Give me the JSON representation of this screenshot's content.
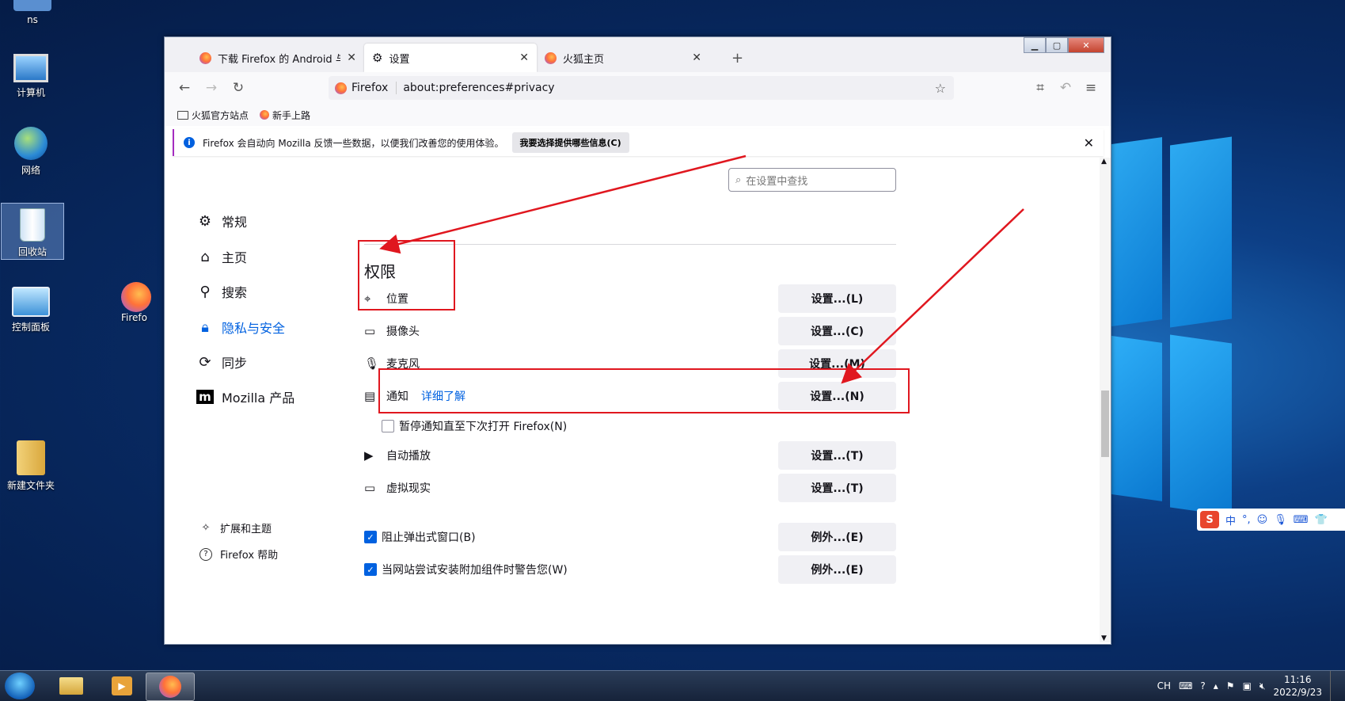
{
  "desktop": {
    "icons": [
      {
        "label": "ns"
      },
      {
        "label": "计算机"
      },
      {
        "label": "网络"
      },
      {
        "label": "回收站"
      },
      {
        "label": "控制面板"
      },
      {
        "label": "Firefo"
      },
      {
        "label": "新建文件夹"
      }
    ]
  },
  "browser": {
    "tabs": [
      {
        "label": "下载 Firefox 的 Android 与 iOS"
      },
      {
        "label": "设置"
      },
      {
        "label": "火狐主页"
      }
    ],
    "url_brand": "Firefox",
    "url": "about:preferences#privacy",
    "bookmarks": [
      {
        "label": "火狐官方站点"
      },
      {
        "label": "新手上路"
      }
    ],
    "notice": {
      "text": "Firefox 会自动向 Mozilla 反馈一些数据，以便我们改善您的使用体验。",
      "button": "我要选择提供哪些信息(C)"
    }
  },
  "settings": {
    "search_placeholder": "在设置中查找",
    "sidebar": [
      {
        "label": "常规"
      },
      {
        "label": "主页"
      },
      {
        "label": "搜索"
      },
      {
        "label": "隐私与安全"
      },
      {
        "label": "同步"
      },
      {
        "label": "Mozilla 产品"
      }
    ],
    "sidebar_bottom": [
      {
        "label": "扩展和主题"
      },
      {
        "label": "Firefox 帮助"
      }
    ],
    "section_title": "权限",
    "permissions": [
      {
        "label": "位置",
        "button": "设置...(L)"
      },
      {
        "label": "摄像头",
        "button": "设置...(C)"
      },
      {
        "label": "麦克风",
        "button": "设置...(M)"
      },
      {
        "label": "通知",
        "link": "详细了解",
        "button": "设置...(N)"
      },
      {
        "label": "暂停通知直至下次打开 Firefox(N)"
      },
      {
        "label": "自动播放",
        "button": "设置...(T)"
      },
      {
        "label": "虚拟现实",
        "button": "设置...(T)"
      },
      {
        "label": "阻止弹出式窗口(B)",
        "button": "例外...(E)",
        "checked": true
      },
      {
        "label": "当网站尝试安装附加组件时警告您(W)",
        "button": "例外...(E)",
        "checked": true
      }
    ]
  },
  "ime": {
    "lang": "中"
  },
  "taskbar": {
    "tray_lang": "CH",
    "time": "11:16",
    "date": "2022/9/23"
  },
  "colors": {
    "accent": "#0061e0",
    "annotation": "#e0171f"
  }
}
